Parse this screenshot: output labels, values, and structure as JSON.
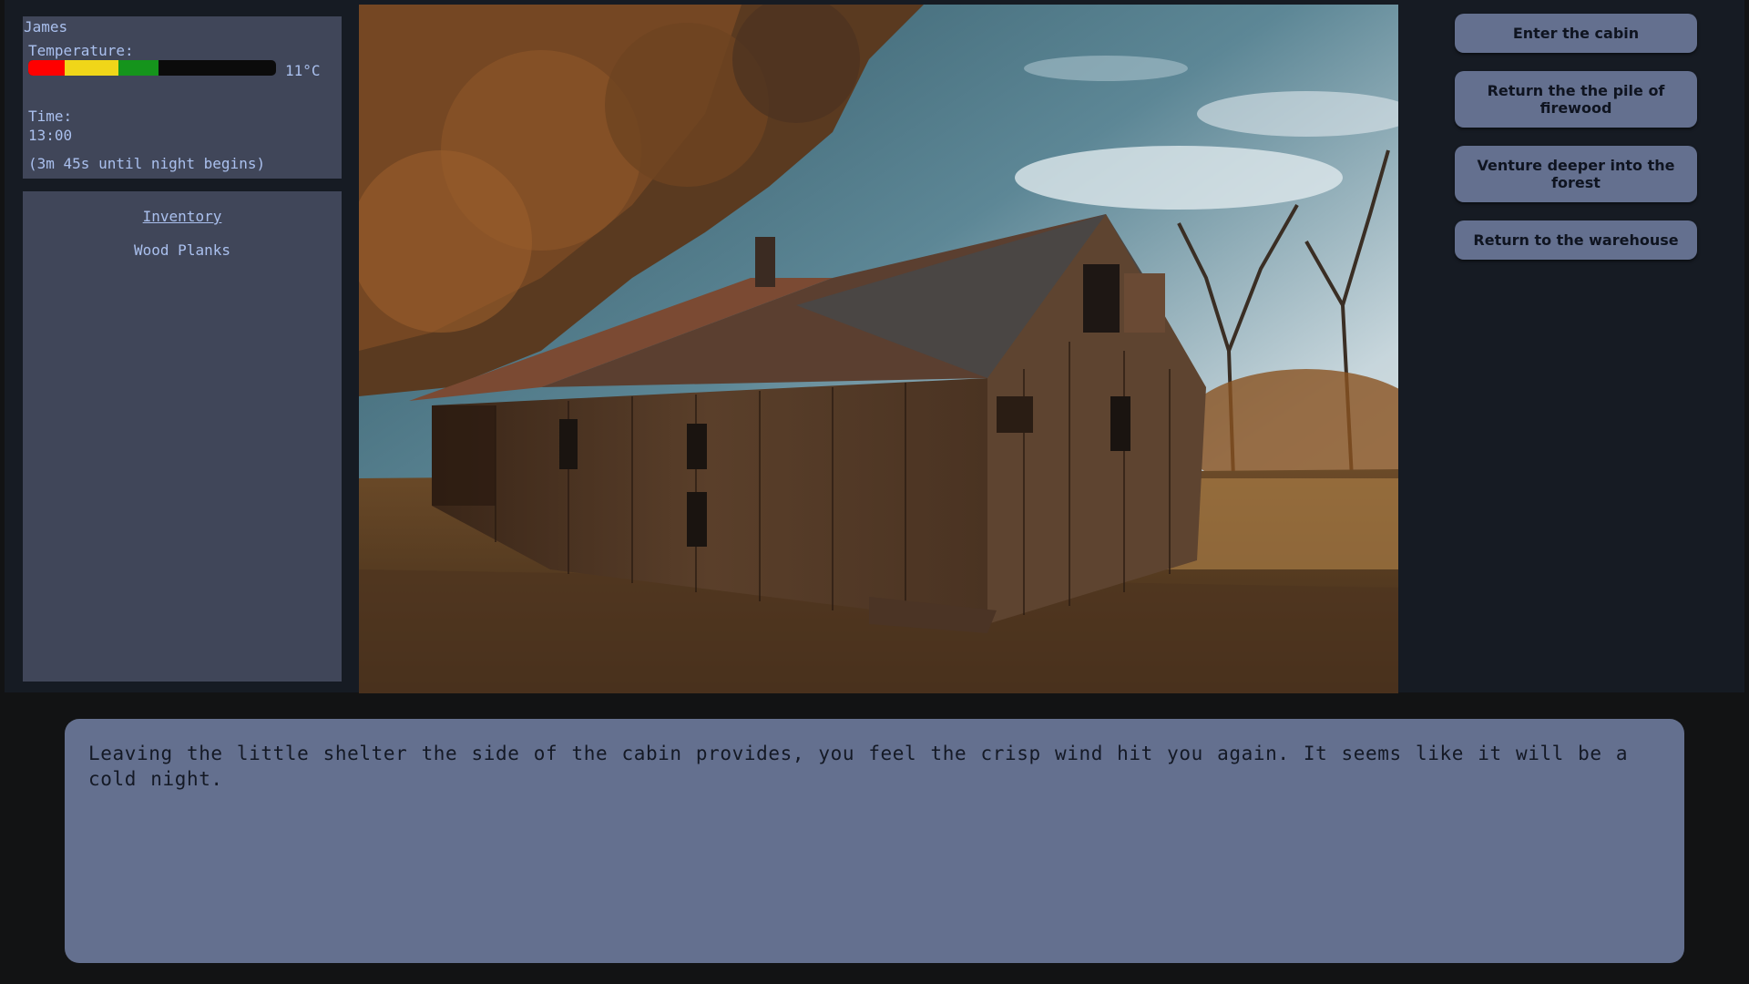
{
  "status": {
    "player_name": "James",
    "temperature_label": "Temperature:",
    "temperature_value": "11°C",
    "temperature_gauge_fraction": 0.53,
    "time_label": "Time:",
    "time_value": "13:00",
    "night_countdown": "(3m 45s until night begins)"
  },
  "inventory": {
    "title": "Inventory",
    "items": [
      "Wood Planks"
    ]
  },
  "scene": {
    "icon": "abandoned-wooden-cabin-in-autumn-forest"
  },
  "actions": [
    {
      "label": "Enter the cabin"
    },
    {
      "label": "Return the the pile of firewood"
    },
    {
      "label": "Venture deeper into the forest"
    },
    {
      "label": "Return to the warehouse"
    }
  ],
  "narrative": {
    "text": "Leaving the little shelter the side of the cabin provides, you feel the crisp wind hit you again. It seems like it will be a cold night."
  },
  "colors": {
    "panel_bg": "#404659",
    "panel_text": "#aac0ee",
    "button_bg": "#64708f",
    "page_bg": "#121314",
    "temp_red": "#ff0000",
    "temp_yellow": "#f0d619",
    "temp_green": "#15941c"
  }
}
